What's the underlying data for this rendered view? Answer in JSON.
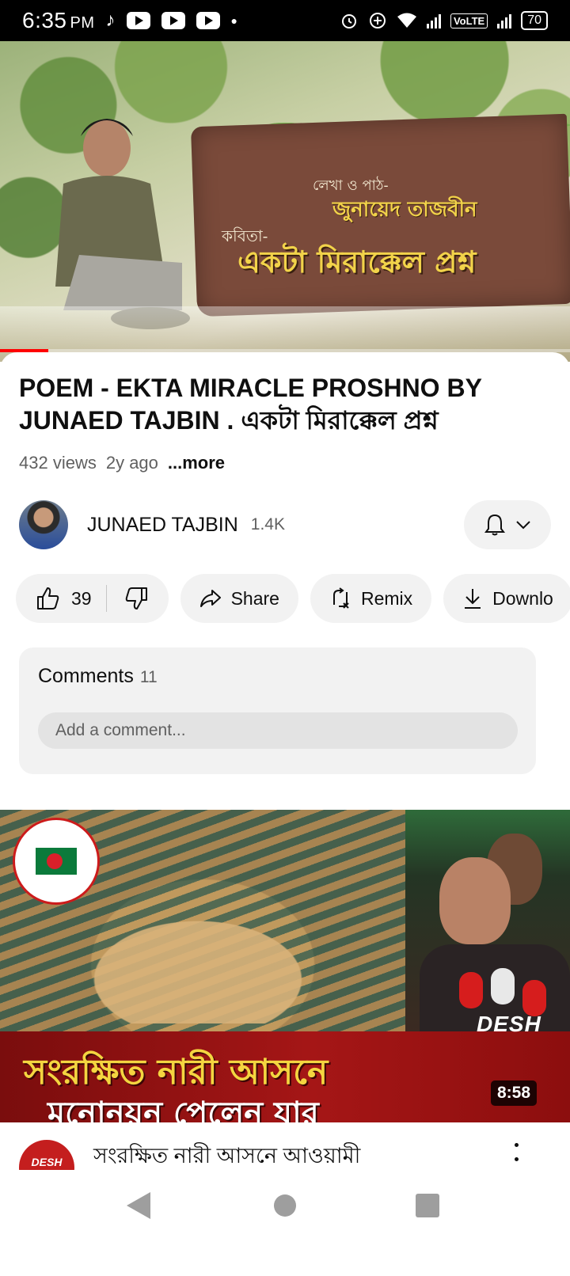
{
  "status_bar": {
    "time": "6:35",
    "ampm": "PM",
    "volte": "VoLTE",
    "battery": "70"
  },
  "video": {
    "thumbnail_text": {
      "small_caption": "লেখা ও পাঠ-",
      "author": "জুনায়েদ তাজবীন",
      "label": "কবিতা-",
      "title": "একটা মিরাক্কেল প্রশ্ন"
    },
    "progress_fraction": 0.085,
    "title": "POEM - EKTA MIRACLE PROSHNO BY JUNAED TAJBIN . একটা মিরাক্কেল প্রশ্ন",
    "views": "432 views",
    "age": "2y ago",
    "more_label": "...more"
  },
  "channel": {
    "name": "JUNAED TAJBIN",
    "subscribers": "1.4K"
  },
  "actions": {
    "likes": "39",
    "share": "Share",
    "remix": "Remix",
    "download": "Downlo"
  },
  "comments": {
    "label": "Comments",
    "count": "11",
    "placeholder": "Add a comment..."
  },
  "next_video": {
    "banner_line1": "সংরক্ষিত নারী আসনে",
    "banner_line2": "মনোনয়ন পেলেন যার",
    "logo_text": "DESH",
    "duration": "8:58",
    "channel_avatar_text": "DESH",
    "title": "সংরক্ষিত নারী আসনে আওয়ামী"
  },
  "colors": {
    "accent_red": "#ff0000",
    "pill_bg": "#f2f2f2",
    "text_primary": "#0f0f0f",
    "text_secondary": "#606060"
  }
}
